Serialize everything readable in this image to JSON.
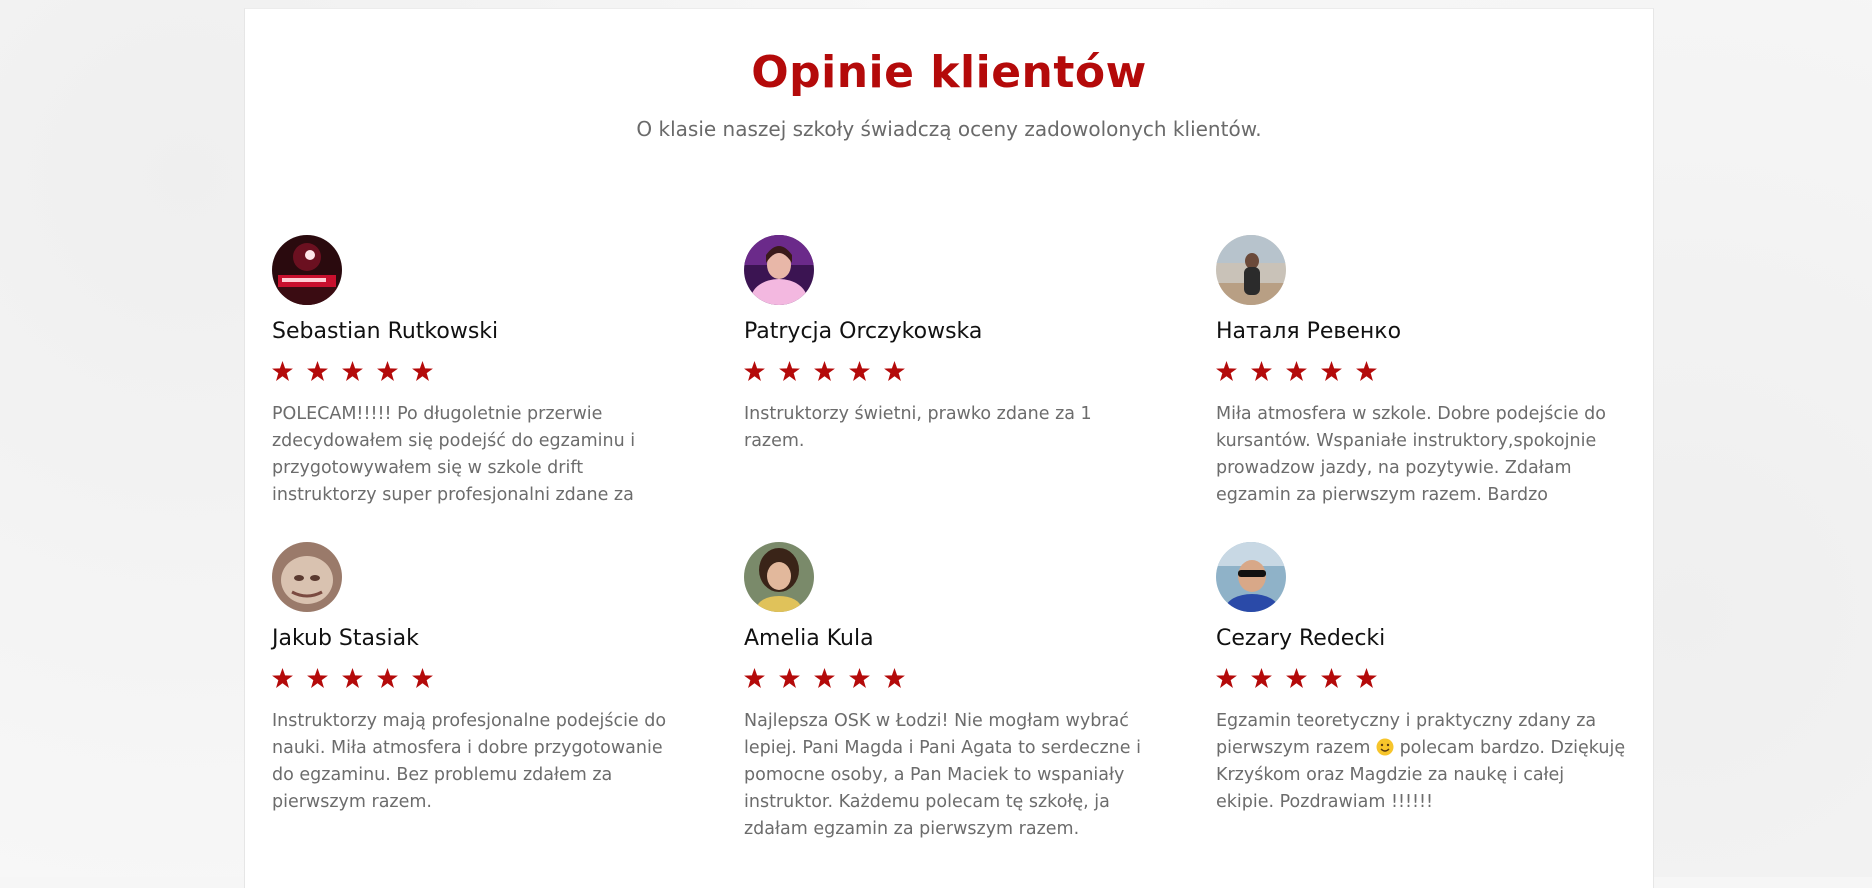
{
  "section": {
    "title": "Opinie klientów",
    "subtitle": "O klasie naszej szkoły świadczą oceny zadowolonych klientów."
  },
  "colors": {
    "accent": "#b40a0a",
    "text_muted": "#6c6c6c"
  },
  "reviews": [
    {
      "name": "Sebastian Rutkowski",
      "rating": 5,
      "text": "POLECAM!!!!! Po długoletnie przerwie zdecydowałem się podejść do egzaminu i przygotowywałem się w szkole drift instruktorzy super profesjonalni zdane za pierwszym"
    },
    {
      "name": "Patrycja Orczykowska",
      "rating": 5,
      "text": "Instruktorzy świetni, prawko zdane za 1 razem."
    },
    {
      "name": "Наталя Ревенко",
      "rating": 5,
      "text": "Miła atmosfera w szkole. Dobre podejście do kursantów. Wspaniałe instruktory,spokojnie prowadzow jazdy, na pozytywie. Zdałam egzamin za pierwszym razem. Bardzo polecam..."
    },
    {
      "name": "Jakub Stasiak",
      "rating": 5,
      "text": "Instruktorzy mają profesjonalne podejście do nauki. Miła atmosfera i dobre przygotowanie do egzaminu. Bez problemu zdałem za pierwszym razem."
    },
    {
      "name": "Amelia Kula",
      "rating": 5,
      "text": "Najlepsza OSK w Łodzi! Nie mogłam wybrać lepiej. Pani Magda i Pani Agata to serdeczne i pomocne osoby, a Pan Maciek to wspaniały instruktor. Każdemu polecam tę szkołę, ja zdałam egzamin za pierwszym razem."
    },
    {
      "name": "Cezary Redecki",
      "rating": 5,
      "text_before_emoji": "Egzamin teoretyczny i praktyczny zdany za pierwszym razem ",
      "emoji": "smiley-emoji-icon",
      "text_after_emoji": " polecam bardzo. Dziękuję Krzyśkom oraz Magdzie za naukę i całej ekipie. Pozdrawiam !!!!!!"
    }
  ]
}
